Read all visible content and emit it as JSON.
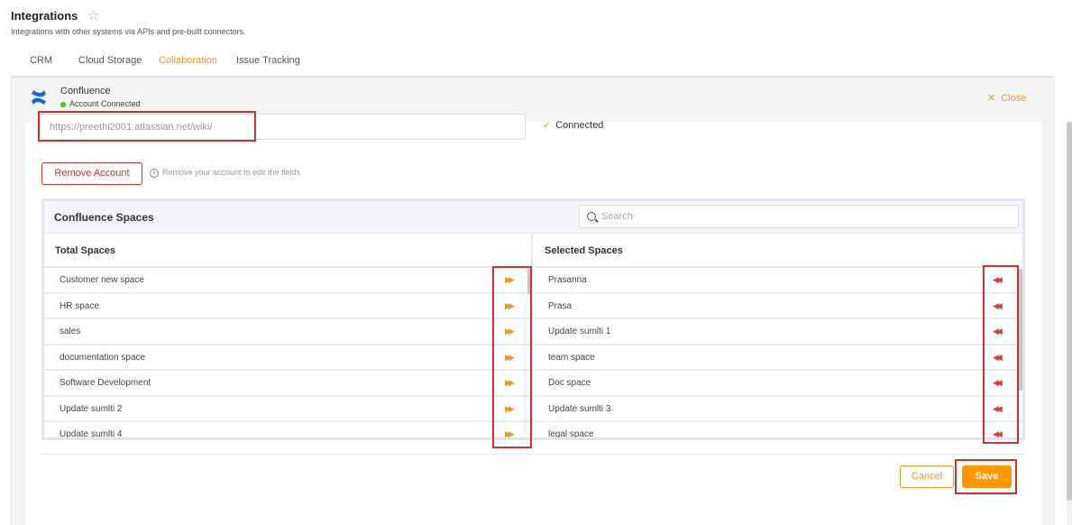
{
  "page": {
    "title": "Integrations",
    "subtitle": "Integrations with other systems via APIs and pre-built connectors."
  },
  "tabs": [
    {
      "label": "CRM",
      "active": false
    },
    {
      "label": "Cloud Storage",
      "active": false
    },
    {
      "label": "Collaboration",
      "active": true
    },
    {
      "label": "Issue Tracking",
      "active": false
    }
  ],
  "connector": {
    "name": "Confluence",
    "status": "Account Connected",
    "close_label": "Close",
    "url_value": "https://preethi2001.atlassian.net/wiki/",
    "connected_label": "Connected",
    "remove_label": "Remove Account",
    "remove_info": "Remove your account to edit the fields"
  },
  "spaces": {
    "title": "Confluence Spaces",
    "search_placeholder": "Search",
    "total_header": "Total Spaces",
    "selected_header": "Selected Spaces",
    "total": [
      "Customer new space",
      "HR space",
      "sales",
      "documentation space",
      "Software Development",
      "Update sumlti 2",
      "Update sumlti 4"
    ],
    "selected": [
      "Prasanna",
      "Prasa",
      "Update sumlti 1",
      "team space",
      "Doc space",
      "Update sumlti 3",
      "legal space"
    ]
  },
  "footer": {
    "cancel_label": "Cancel",
    "save_label": "Save"
  },
  "colors": {
    "accent": "#f7941d",
    "highlight": "#d32f2f",
    "remove_arrow": "#e53935",
    "connected_dot": "#52c41a"
  },
  "icons": {
    "add_arrow": "▶▶",
    "remove_arrow": "◀◀",
    "star": "☆",
    "close": "✕",
    "check": "✓",
    "info": "i"
  }
}
